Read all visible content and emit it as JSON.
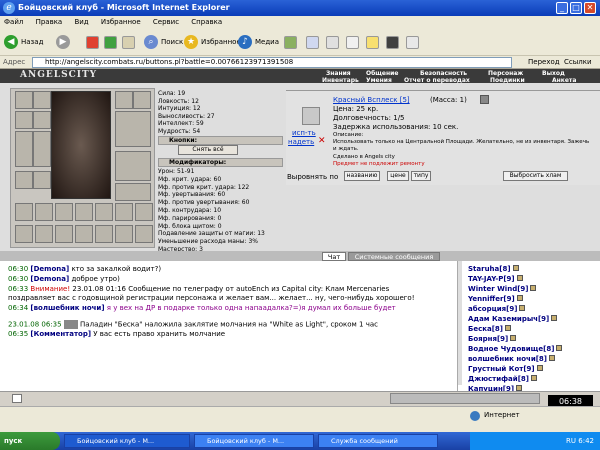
{
  "window": {
    "title": "Бойцовский клуб - Microsoft Internet Explorer"
  },
  "menubar": {
    "items": [
      "Файл",
      "Правка",
      "Вид",
      "Избранное",
      "Сервис",
      "Справка"
    ]
  },
  "toolbar": {
    "back": "Назад",
    "search": "Поиск",
    "favorites": "Избранное",
    "media": "Медиа"
  },
  "addressbar": {
    "label": "Адрес",
    "url": "http://angelscity.combats.ru/buttons.pl?battle=0.00766123971391508",
    "go": "Переход",
    "links": "Ссылки"
  },
  "game": {
    "logo": "ANGELSCITY",
    "top_menu": [
      "Знания",
      "Общение",
      "Безопасность",
      "Персонаж",
      "Выход"
    ],
    "sub_menu": [
      "Инвентарь",
      "Умения",
      "Отчет о переводах",
      "Поединки",
      "Анкета"
    ],
    "stats": [
      "Сила: 19",
      "Ловкость: 12",
      "Интуиция: 12",
      "Выносливость: 27",
      "Интеллект: 59",
      "Мудрость: 54"
    ],
    "sections": {
      "buttons": "Кнопки:",
      "remove_all": "Снять всё",
      "modifiers": "Модификаторы:"
    },
    "modifiers": [
      "Урон: 51-91",
      "Мф. крит. удара: 60",
      "Мф. против крит. удара: 122",
      "Мф. увертывания: 60",
      "Мф. против увертывания: 60",
      "Мф. контрудара: 10",
      "Мф. парирования: 0",
      "Мф. блока щитом: 0",
      "Подавление защиты от магии: 13",
      "Уменьшение расхода маны: 3%",
      "Мастерство: 3"
    ],
    "item": {
      "use_label": "исп-ть",
      "wear_label": "надеть",
      "name": "Красный Всплеск [5]",
      "mass": "(Масса: 1)",
      "price": "Цена: 25 кр.",
      "durability": "Долговечность: 1/5",
      "delay": "Задержка использования: 10 сек.",
      "desc_label": "Описание:",
      "desc": "Использовать только на Центральной Площади. Желательно, не из инвентаря. Зажечь и ждать.",
      "made": "Сделано в Angels city",
      "no_repair": "Предмет не подлежит ремонту"
    },
    "align": {
      "label": "Выровнять по",
      "by_name": "названию",
      "by_price": "цене",
      "by_type": "типу",
      "throw": "Выбросить хлам"
    }
  },
  "chat": {
    "tabs": [
      "Чат",
      "Системные сообщения"
    ],
    "messages": [
      {
        "time": "06:30",
        "who": "[Demona]",
        "text": "кто за закалкой водит?)"
      },
      {
        "time": "06:30",
        "who": "[Demona]",
        "text": "доброе утро)"
      },
      {
        "time": "06:33",
        "who": "Внимание!",
        "text": "23.01.08 01:16 Сообщение по телеграфу от autoEnch из Capital city: Клам Mercenaries"
      },
      {
        "time": "",
        "who": "",
        "text": "поздравляет вас с годовщиной регистрации персонажа и желает вам... желает... ну, чего-нибудь хорошего!"
      },
      {
        "time": "06:34",
        "who": "[волшебник ночи]",
        "text": "я у вех на ДР в подарке только одна напаадалка?=)я думал их больше будет"
      },
      {
        "time": "23.01.08 06:35",
        "who": "",
        "text": "Паладин \"Беска\" наложила заклятие молчания на \"White as Light\", сроком 1 час"
      },
      {
        "time": "06:35",
        "who": "[Комментатор]",
        "text": "У вас есть право хранить молчание"
      }
    ],
    "users": [
      "Staruha[8]",
      "TAY-JAY-P[9]",
      "Winter Wind[9]",
      "Yenniffer[9]",
      "абсорция[9]",
      "Адам Каземирыч[9]",
      "Беска[8]",
      "Боярня[9]",
      "Водное Чудовище[8]",
      "волшебник ночи[8]",
      "Грустный Кот[9]",
      "Джюстифай[8]",
      "Капуцин[9]"
    ]
  },
  "statusbar": {
    "zone": "Интернет",
    "clock": "06:38"
  },
  "taskbar": {
    "start": "пуск",
    "tasks": [
      "Бойцовский клуб - M...",
      "Бойцовский клуб - M...",
      "Служба сообщений"
    ],
    "tray_time": "6:42",
    "tray_prefix": "RU"
  }
}
